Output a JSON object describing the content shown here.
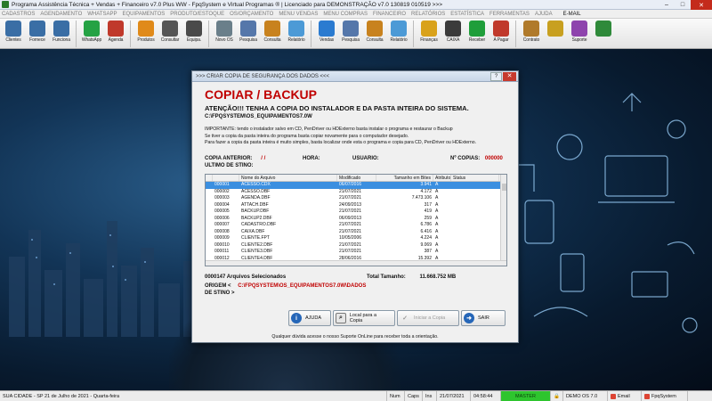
{
  "window": {
    "title": "Programa Assistência Técnica + Vendas + Financeiro v7.0 Plus WW - FpqSystem e Virtual Programas ® | Licenciado para  DEMONSTRAÇÃO v7.0 130819 010519 >>>"
  },
  "menu": [
    "CADASTROS",
    "AGENDAMENTO",
    "WHATSAPP",
    "EQUIPAMENTOS",
    "PRODUTO/ESTOQUE",
    "OS/ORÇAMENTO",
    "MENU VENDAS",
    "MENU COMPRAS",
    "FINANCEIRO",
    "RELATÓRIOS",
    "ESTATÍSTICA",
    "FERRAMENTAS",
    "AJUDA",
    "E-MAIL"
  ],
  "toolbar": [
    {
      "label": "Clientes",
      "color": "#3a6ea5",
      "icon": "users-icon"
    },
    {
      "label": "Fornece",
      "color": "#3a6ea5",
      "icon": "supplier-icon"
    },
    {
      "label": "Funciona",
      "color": "#3a6ea5",
      "icon": "employee-icon"
    },
    {
      "label": "WhatsApp",
      "color": "#25a244",
      "icon": "whatsapp-icon"
    },
    {
      "label": "Agenda",
      "color": "#c0392b",
      "icon": "calendar-icon"
    },
    {
      "label": "Produtos",
      "color": "#e08a1a",
      "icon": "products-icon"
    },
    {
      "label": "Consultar",
      "color": "#555555",
      "icon": "search-icon"
    },
    {
      "label": "Equipa.",
      "color": "#4a4a4a",
      "icon": "equipment-icon"
    },
    {
      "label": "Novo OS",
      "color": "#6a7f8a",
      "icon": "new-os-icon"
    },
    {
      "label": "Pesquisa",
      "color": "#5577aa",
      "icon": "search-icon"
    },
    {
      "label": "Consulta",
      "color": "#c8821e",
      "icon": "consult-icon"
    },
    {
      "label": "Relatório",
      "color": "#4c9ad6",
      "icon": "report-icon"
    },
    {
      "label": "Vendas",
      "color": "#2b7bd0",
      "icon": "sales-icon"
    },
    {
      "label": "Pesquisa",
      "color": "#5577aa",
      "icon": "search-icon"
    },
    {
      "label": "Consulta",
      "color": "#c8821e",
      "icon": "consult-icon"
    },
    {
      "label": "Relatório",
      "color": "#4c9ad6",
      "icon": "report-icon"
    },
    {
      "label": "Finanças",
      "color": "#d9a21b",
      "icon": "finance-icon"
    },
    {
      "label": "CAIXA",
      "color": "#3b3b3b",
      "icon": "cash-icon"
    },
    {
      "label": "Receber",
      "color": "#1f9e3a",
      "icon": "receive-icon"
    },
    {
      "label": "A Pagar",
      "color": "#c0392b",
      "icon": "pay-icon"
    },
    {
      "label": "Contrato",
      "color": "#b07a2a",
      "icon": "contract-icon"
    },
    {
      "label": "",
      "color": "#c8a020",
      "icon": "coins-icon"
    },
    {
      "label": "Suporte",
      "color": "#8e44ad",
      "icon": "support-icon"
    },
    {
      "label": "",
      "color": "#2f8a3a",
      "icon": "exit-icon"
    }
  ],
  "dialog": {
    "title": ">>> CRIAR COPIA DE SEGURANÇA DOS DADOS <<<",
    "heading": "COPIAR / BACKUP",
    "attention": "ATENÇÃO!!!  TENHA A COPIA DO  INSTALADOR  E  DA PASTA INTEIRA DO  SISTEMA.",
    "attention_path": "C:\\FPQSYSTEM\\OS_EQUIPAMENTOS7.0W",
    "info_lines": [
      "IMPORTANTE: tendo o instalador salvo em CD, PenDriver ou HDExterno basta instalar o programa e restaurar o Backup",
      "Se tiver a copia da pasta inteira do programa basta copiar novamente para o computador desejado.",
      "Para fazer a copia da pasta inteira é muito simples, basta localizar onde esta o programa e copia para CD, PenDriver ou HDExterno."
    ],
    "copia_anterior_label": "COPIA ANTERIOR:",
    "copia_anterior_value": "/  /",
    "hora_label": "HORA:",
    "usuario_label": "USUARIO:",
    "n_copias_label": "Nº COPIAS:",
    "n_copias_value": "000000",
    "ultimo_destino_label": "ULTIMO DE STINO:",
    "table": {
      "columns": [
        "",
        "",
        "Nome do Arquivo",
        "Modificado",
        "Tamanho em Bites",
        "Atributo",
        "Status"
      ],
      "rows": [
        [
          "000001",
          "ACESSO.CDX",
          "06/07/2016",
          "3.941",
          "A",
          ""
        ],
        [
          "000002",
          "ACESSO.DBF",
          "21/07/2021",
          "4.172",
          "A",
          ""
        ],
        [
          "000003",
          "AGENDA.DBF",
          "21/07/2021",
          "7.473.106",
          "A",
          ""
        ],
        [
          "000004",
          "ATTACH.DBF",
          "24/09/2013",
          "317",
          "A",
          ""
        ],
        [
          "000005",
          "BACKUP.DBF",
          "21/07/2021",
          "419",
          "A",
          ""
        ],
        [
          "000006",
          "BACKUP2.DBF",
          "06/09/2013",
          "259",
          "A",
          ""
        ],
        [
          "000007",
          "CADASTRO.DBF",
          "21/07/2021",
          "6.786",
          "A",
          ""
        ],
        [
          "000008",
          "CAIXA.DBF",
          "21/07/2021",
          "6.416",
          "A",
          ""
        ],
        [
          "000009",
          "CLIENTE.FPT",
          "10/05/2006",
          "4.224",
          "A",
          ""
        ],
        [
          "000010",
          "CLIENTE2.DBF",
          "21/07/2021",
          "9.069",
          "A",
          ""
        ],
        [
          "000011",
          "CLIENTE3.DBF",
          "21/07/2021",
          "387",
          "A",
          ""
        ],
        [
          "000012",
          "CLIENTE4.DBF",
          "28/06/2016",
          "15.392",
          "A",
          ""
        ],
        [
          "000013",
          "CLIENTE5.DBF",
          "21/07/2021",
          "33.116",
          "A",
          ""
        ]
      ]
    },
    "selected_count": "0000147 Arquivos Selecionados",
    "total_label": "Total Tamanho:",
    "total_value": "11.668.752 MB",
    "origem_label": "ORIGEM  <",
    "origem_value": "C:\\FPQSYSTEM\\OS_EQUIPAMENTOS7.0W\\DADOS",
    "destino_label": "DE STINO >",
    "buttons": {
      "ajuda": "AJUDA",
      "local": "Local para a Copia",
      "iniciar": "Iniciar a Copia",
      "sair": "SAIR"
    },
    "footnote": "Qualquer dúvida acesse o nosso Suporte OnLine para receber toda a orientação."
  },
  "status": {
    "city": "SUA CIDADE - SP 21 de Julho de 2021 - Quarta-feira",
    "num": "Num",
    "caps": "Caps",
    "ins": "Ins",
    "date": "21/07/2021",
    "time": "04:58:44",
    "master": "MASTER",
    "demo": "DEMO OS 7.0",
    "email": "Email",
    "brand": "FpqSystem"
  }
}
